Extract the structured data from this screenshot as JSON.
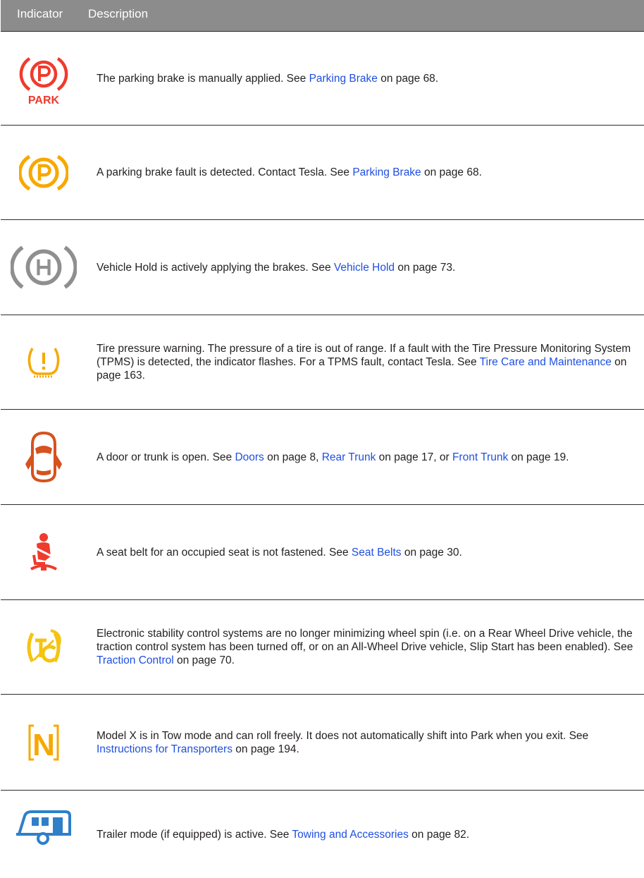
{
  "header": {
    "indicator": "Indicator",
    "description": "Description"
  },
  "colors": {
    "red": "#ef3b2d",
    "amber": "#f7a800",
    "gray": "#8f8f8f",
    "orange": "#d6521e",
    "yellow": "#f4c40f",
    "blue": "#2f7fc8",
    "link": "#1f4fe0"
  },
  "rows": [
    {
      "icon": "park-brake-red-icon",
      "icon_text": "PARK",
      "segments": [
        {
          "t": "The parking brake is manually applied. See "
        },
        {
          "t": "Parking Brake",
          "link": true
        },
        {
          "t": " on page 68."
        }
      ]
    },
    {
      "icon": "park-brake-fault-icon",
      "segments": [
        {
          "t": "A parking brake fault is detected. Contact Tesla. See "
        },
        {
          "t": "Parking Brake",
          "link": true
        },
        {
          "t": " on page 68."
        }
      ]
    },
    {
      "icon": "vehicle-hold-icon",
      "segments": [
        {
          "t": "Vehicle Hold is actively applying the brakes. See "
        },
        {
          "t": "Vehicle Hold",
          "link": true
        },
        {
          "t": " on page 73."
        }
      ]
    },
    {
      "icon": "tire-pressure-icon",
      "segments": [
        {
          "t": "Tire pressure warning. The pressure of a tire is out of range. If a fault with the Tire Pressure Monitoring System (TPMS) is detected, the indicator flashes. For a TPMS fault, contact Tesla. See "
        },
        {
          "t": "Tire Care and Maintenance",
          "link": true
        },
        {
          "t": " on page 163."
        }
      ]
    },
    {
      "icon": "door-open-icon",
      "segments": [
        {
          "t": "A door or trunk is open. See "
        },
        {
          "t": "Doors",
          "link": true
        },
        {
          "t": " on page 8, "
        },
        {
          "t": "Rear Trunk",
          "link": true
        },
        {
          "t": " on page 17, or "
        },
        {
          "t": "Front Trunk",
          "link": true
        },
        {
          "t": " on page 19."
        }
      ]
    },
    {
      "icon": "seat-belt-icon",
      "segments": [
        {
          "t": "A seat belt for an occupied seat is not fastened. See "
        },
        {
          "t": "Seat Belts",
          "link": true
        },
        {
          "t": " on page 30."
        }
      ]
    },
    {
      "icon": "traction-control-off-icon",
      "segments": [
        {
          "t": "Electronic stability control systems are no longer minimizing wheel spin (i.e. on a Rear Wheel Drive vehicle, the traction control system has been turned off, or on an All-Wheel Drive vehicle, Slip Start has been enabled). See "
        },
        {
          "t": "Traction Control",
          "link": true
        },
        {
          "t": " on page 70."
        }
      ]
    },
    {
      "icon": "tow-mode-icon",
      "icon_text": "N",
      "segments": [
        {
          "t": "Model X is in Tow mode and can roll freely. It does not automatically shift into Park when you exit. See "
        },
        {
          "t": "Instructions for Transporters",
          "link": true
        },
        {
          "t": " on page 194."
        }
      ]
    },
    {
      "icon": "trailer-mode-icon",
      "segments": [
        {
          "t": "Trailer mode (if equipped) is active. See "
        },
        {
          "t": "Towing and Accessories",
          "link": true
        },
        {
          "t": " on page 82."
        }
      ]
    }
  ]
}
